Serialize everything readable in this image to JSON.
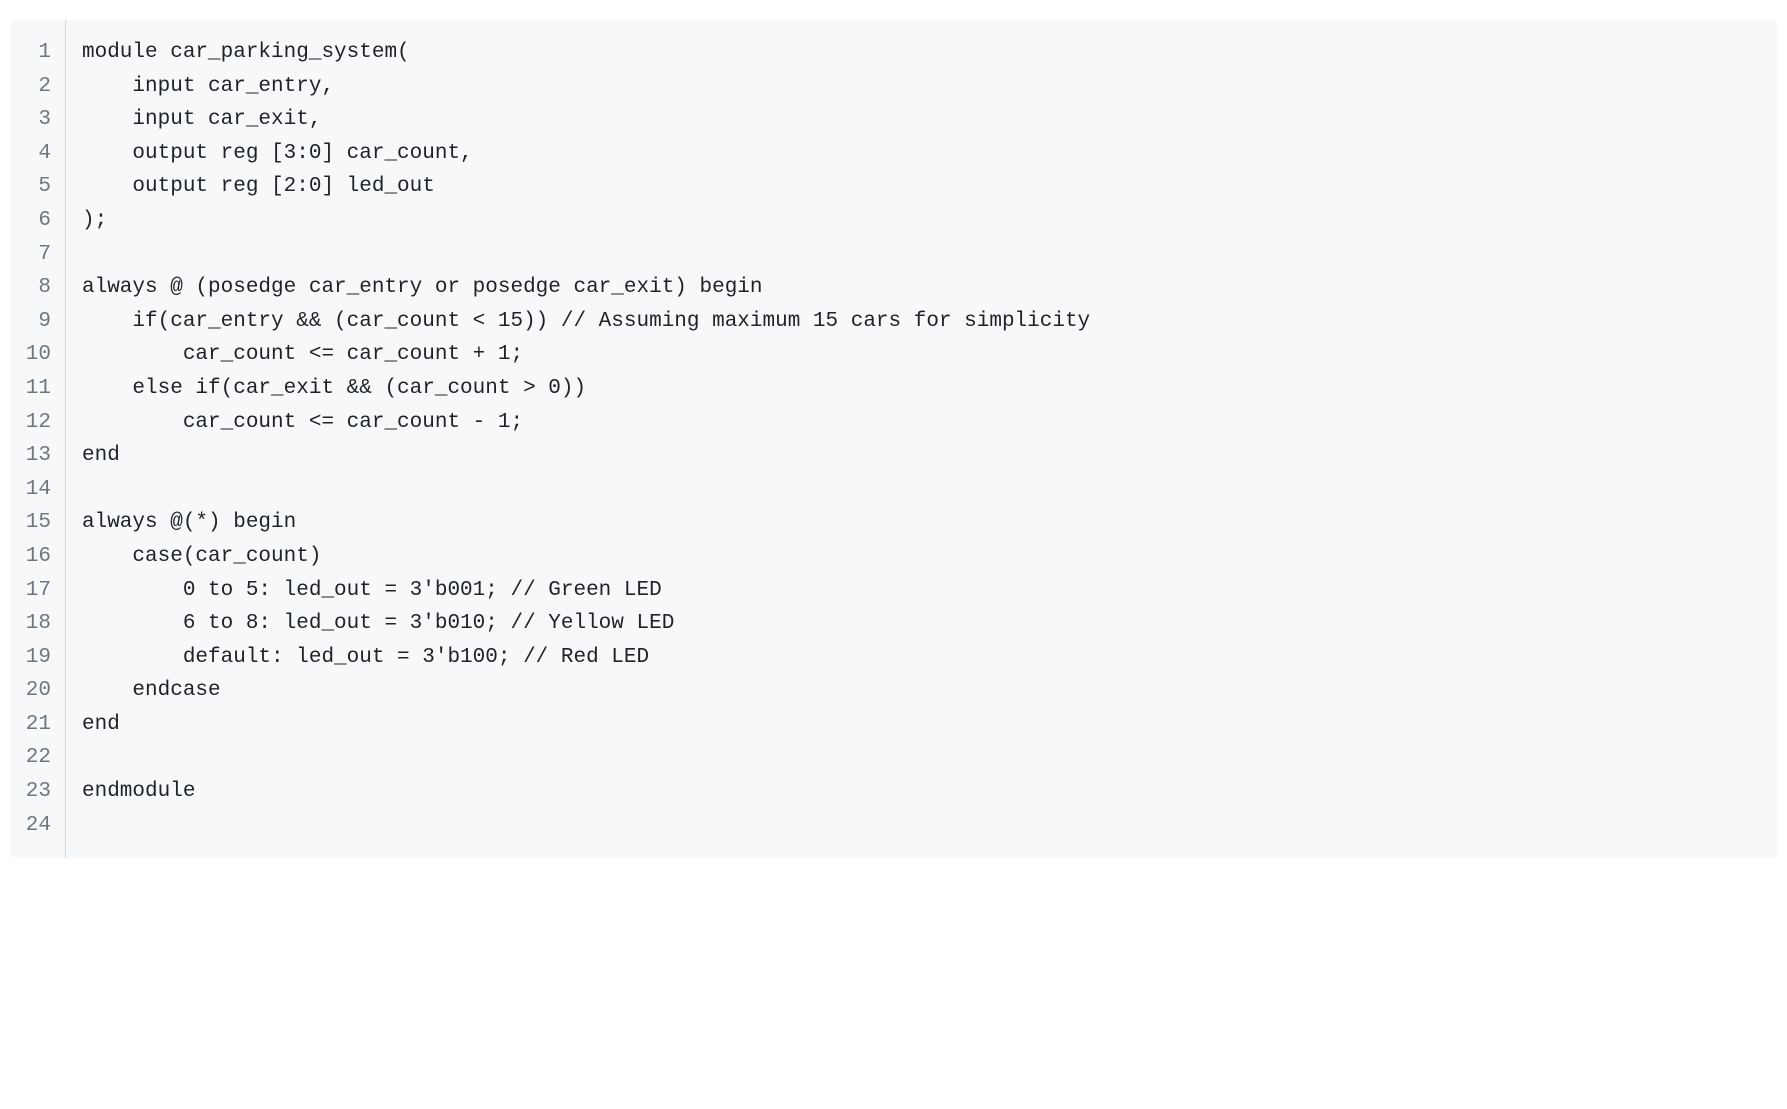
{
  "code": {
    "language": "verilog",
    "lines": [
      {
        "num": "1",
        "text": "module car_parking_system("
      },
      {
        "num": "2",
        "text": "    input car_entry,"
      },
      {
        "num": "3",
        "text": "    input car_exit,"
      },
      {
        "num": "4",
        "text": "    output reg [3:0] car_count,"
      },
      {
        "num": "5",
        "text": "    output reg [2:0] led_out"
      },
      {
        "num": "6",
        "text": ");"
      },
      {
        "num": "7",
        "text": ""
      },
      {
        "num": "8",
        "text": "always @ (posedge car_entry or posedge car_exit) begin"
      },
      {
        "num": "9",
        "text": "    if(car_entry && (car_count < 15)) // Assuming maximum 15 cars for simplicity"
      },
      {
        "num": "10",
        "text": "        car_count <= car_count + 1;"
      },
      {
        "num": "11",
        "text": "    else if(car_exit && (car_count > 0))"
      },
      {
        "num": "12",
        "text": "        car_count <= car_count - 1;"
      },
      {
        "num": "13",
        "text": "end"
      },
      {
        "num": "14",
        "text": ""
      },
      {
        "num": "15",
        "text": "always @(*) begin"
      },
      {
        "num": "16",
        "text": "    case(car_count)"
      },
      {
        "num": "17",
        "text": "        0 to 5: led_out = 3'b001; // Green LED"
      },
      {
        "num": "18",
        "text": "        6 to 8: led_out = 3'b010; // Yellow LED"
      },
      {
        "num": "19",
        "text": "        default: led_out = 3'b100; // Red LED"
      },
      {
        "num": "20",
        "text": "    endcase"
      },
      {
        "num": "21",
        "text": "end"
      },
      {
        "num": "22",
        "text": ""
      },
      {
        "num": "23",
        "text": "endmodule"
      },
      {
        "num": "24",
        "text": ""
      }
    ]
  }
}
